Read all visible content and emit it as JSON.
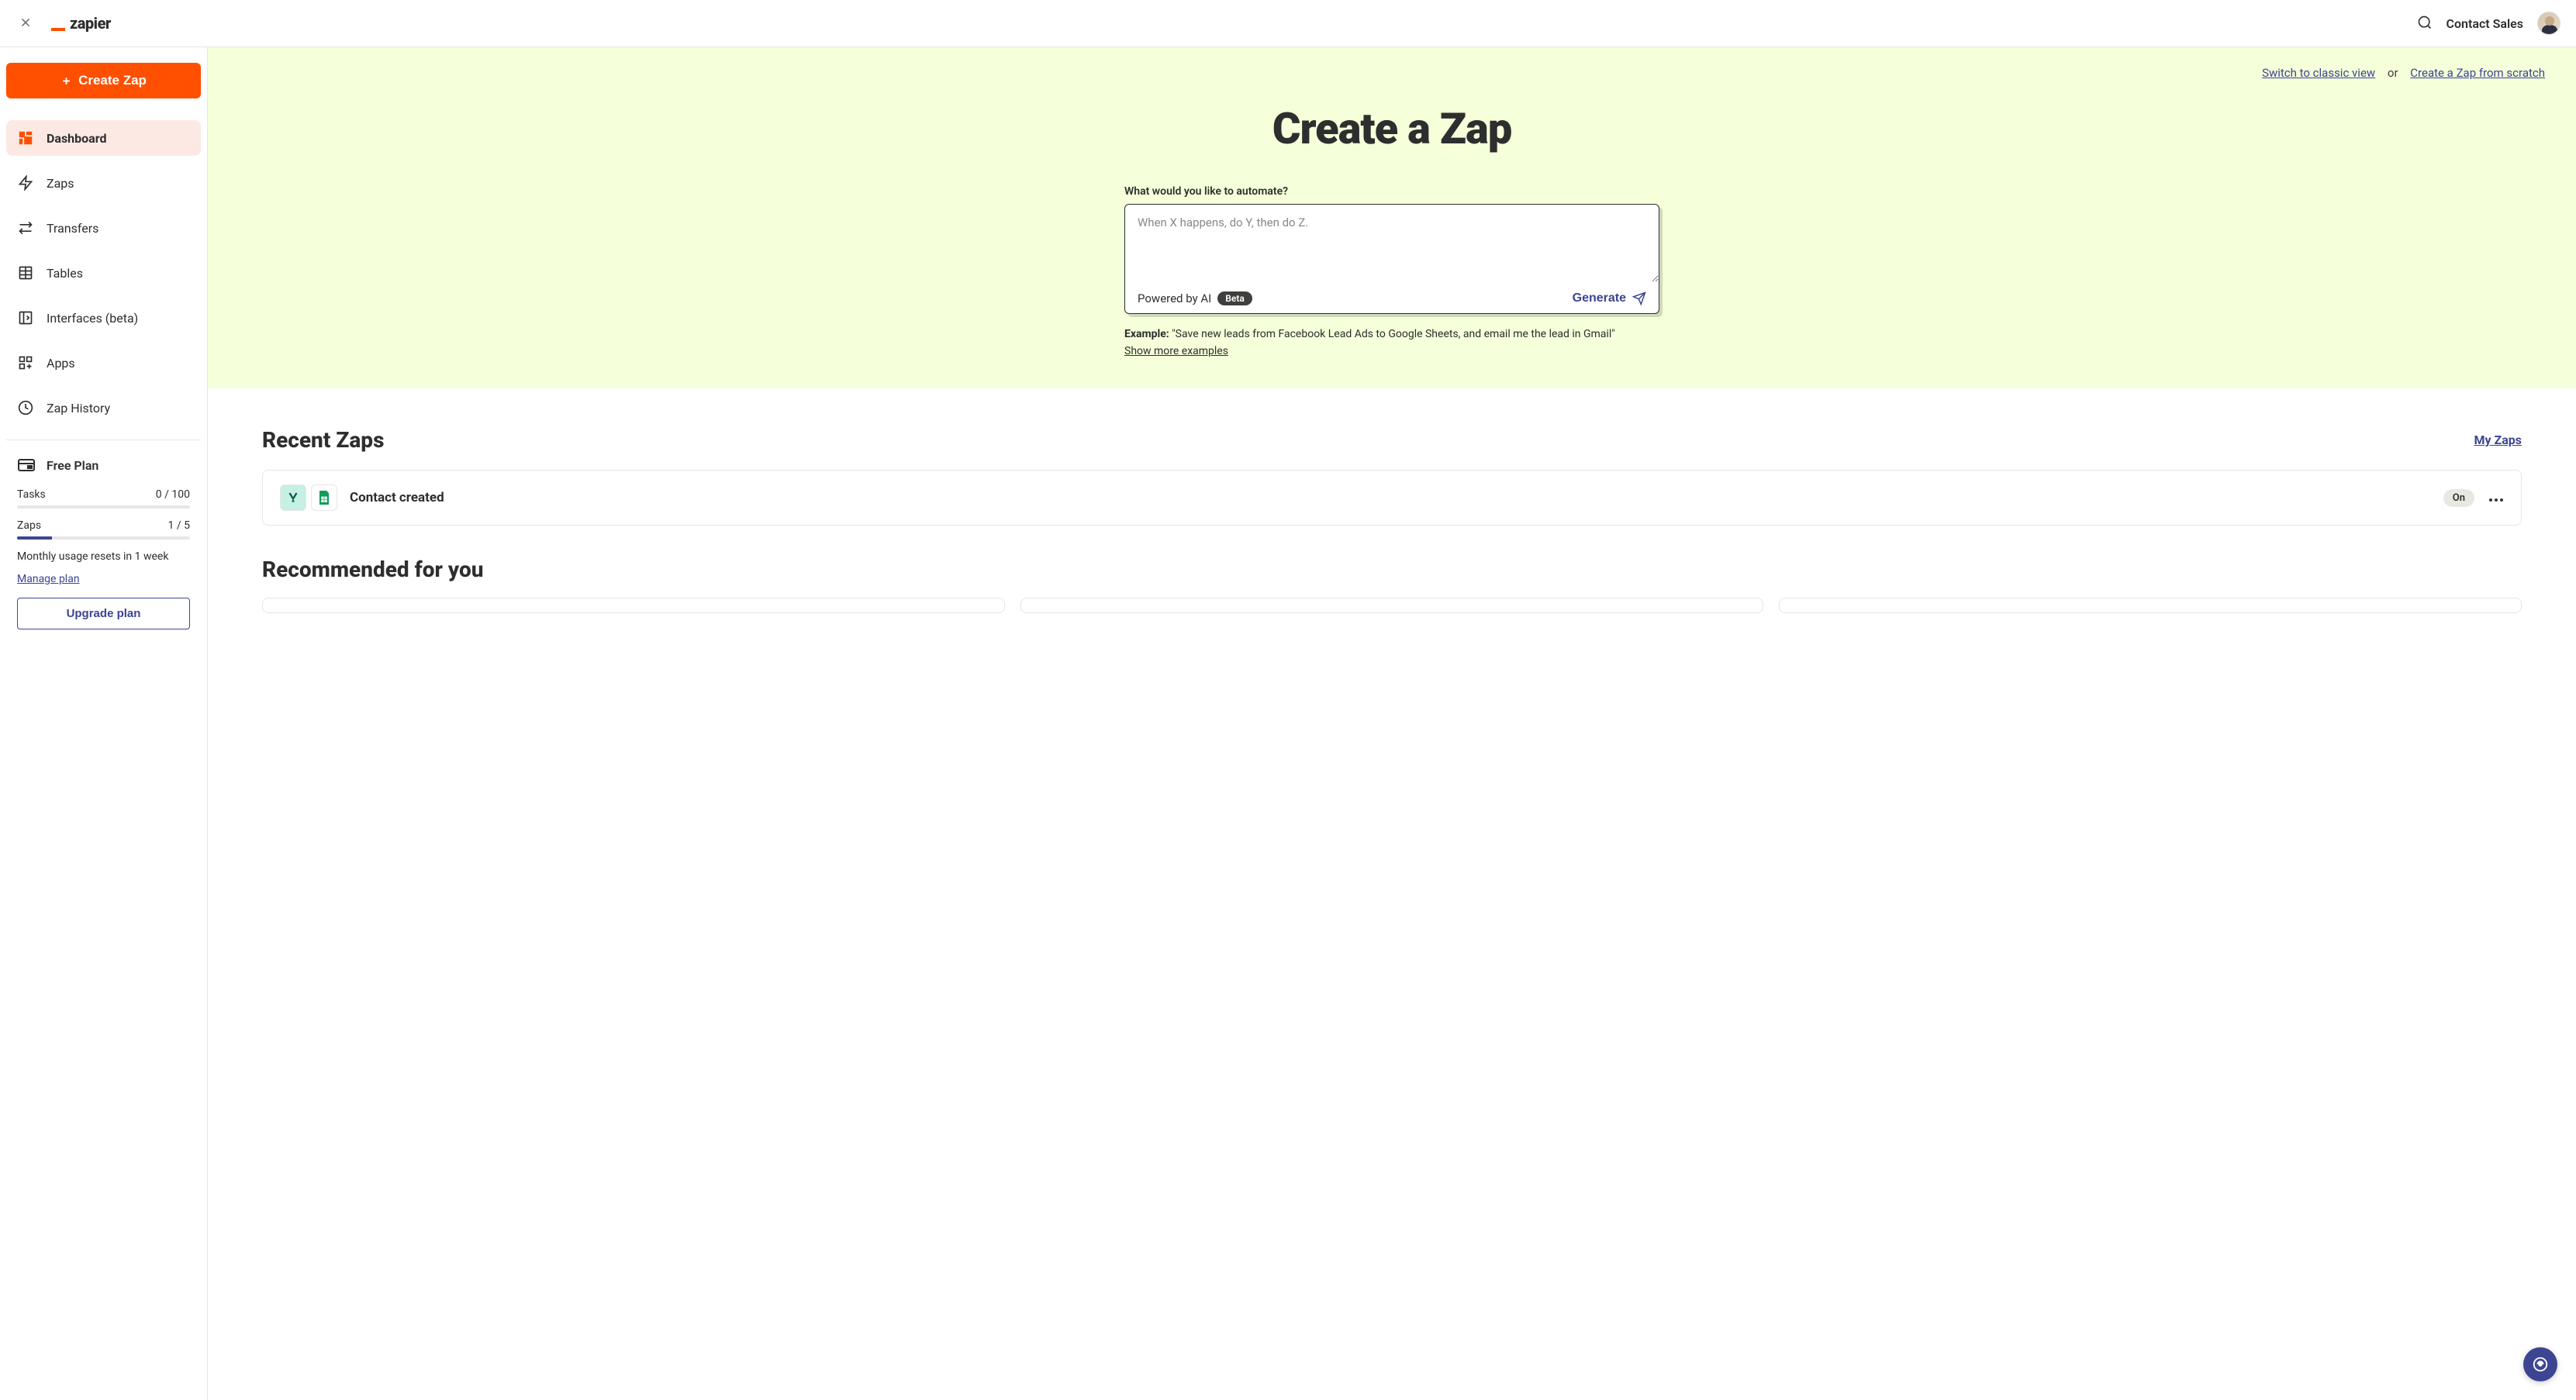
{
  "header": {
    "logo_text": "zapier",
    "contact_sales": "Contact Sales"
  },
  "sidebar": {
    "create_button": "Create Zap",
    "nav": [
      {
        "label": "Dashboard",
        "active": true
      },
      {
        "label": "Zaps",
        "active": false
      },
      {
        "label": "Transfers",
        "active": false
      },
      {
        "label": "Tables",
        "active": false
      },
      {
        "label": "Interfaces (beta)",
        "active": false
      },
      {
        "label": "Apps",
        "active": false
      },
      {
        "label": "Zap History",
        "active": false
      }
    ],
    "plan": {
      "name": "Free Plan",
      "tasks_label": "Tasks",
      "tasks_value": "0 / 100",
      "tasks_percent": 0,
      "zaps_label": "Zaps",
      "zaps_value": "1 / 5",
      "zaps_percent": 20,
      "reset_text": "Monthly usage resets in 1 week",
      "manage_link": "Manage plan",
      "upgrade_button": "Upgrade plan"
    }
  },
  "hero": {
    "switch_classic": "Switch to classic view",
    "or_text": "or",
    "create_scratch": "Create a Zap from scratch",
    "title": "Create a Zap",
    "prompt_label": "What would you like to automate?",
    "placeholder": "When X happens, do Y, then do Z.",
    "powered_text": "Powered by AI",
    "beta_label": "Beta",
    "generate_button": "Generate",
    "example_prefix": "Example:",
    "example_text": "\"Save new leads from Facebook Lead Ads to Google Sheets, and email me the lead in Gmail\"",
    "show_more": "Show more examples"
  },
  "recent": {
    "title": "Recent Zaps",
    "my_zaps_link": "My Zaps",
    "items": [
      {
        "name": "Contact created",
        "status": "On",
        "apps": [
          "yousign",
          "sheets"
        ]
      }
    ]
  },
  "recommended": {
    "title": "Recommended for you"
  }
}
